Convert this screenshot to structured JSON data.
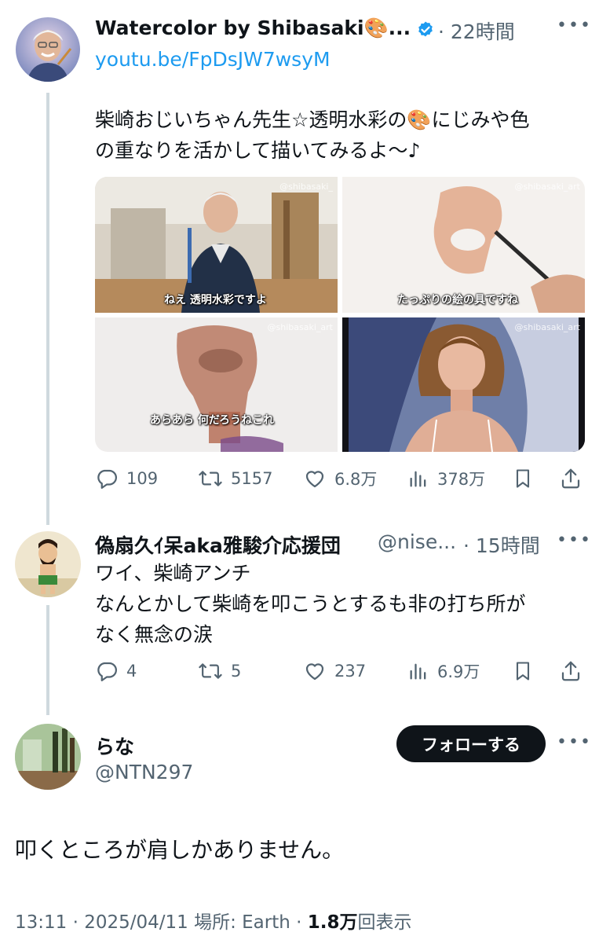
{
  "tweet1": {
    "display_name": "Watercolor by Shibasaki🎨...",
    "time": "· 22時間",
    "link": "youtu.be/FpDsJW7wsyM",
    "text_line1": "柴崎おじいちゃん先生☆透明水彩の🎨にじみや色",
    "text_line2": "の重なりを活かして描いてみるよ～♪",
    "media": [
      {
        "caption": "ねえ 透明水彩ですよ",
        "watermark": "@shibasaki_"
      },
      {
        "caption": "たっぷりの絵の具ですね",
        "watermark": "@shibasaki_art"
      },
      {
        "caption": "あらあら 何だろうねこれ",
        "watermark": "@shibasaki_art"
      },
      {
        "caption": "",
        "watermark": "@shibasaki_art"
      }
    ],
    "replies": "109",
    "retweets": "5157",
    "likes": "6.8万",
    "views": "378万"
  },
  "tweet2": {
    "display_name": "偽扇久ｲ呆aka雅駿介応援団",
    "handle": "@nise...",
    "time": "· 15時間",
    "line1": "ワイ、柴崎アンチ",
    "line2": "なんとかして柴崎を叩こうとするも非の打ち所が",
    "line3": "なく無念の涙",
    "replies": "4",
    "retweets": "5",
    "likes": "237",
    "views": "6.9万"
  },
  "tweet3": {
    "display_name": "らな",
    "handle": "@NTN297",
    "follow_label": "フォローする",
    "text": "叩くところが肩しかありません。",
    "footer_time": "13:11 · 2025/04/11 場所: Earth · ",
    "footer_views": "1.8万",
    "footer_views_label": "回表示"
  },
  "colors": {
    "accent": "#1d9bf0",
    "text": "#0f1419",
    "muted": "#536471",
    "line": "#cfd9de",
    "verified": "#1d9bf0"
  },
  "icons": [
    "reply-icon",
    "retweet-icon",
    "like-icon",
    "views-icon",
    "bookmark-icon",
    "share-icon",
    "verified-badge-icon",
    "more-icon"
  ]
}
